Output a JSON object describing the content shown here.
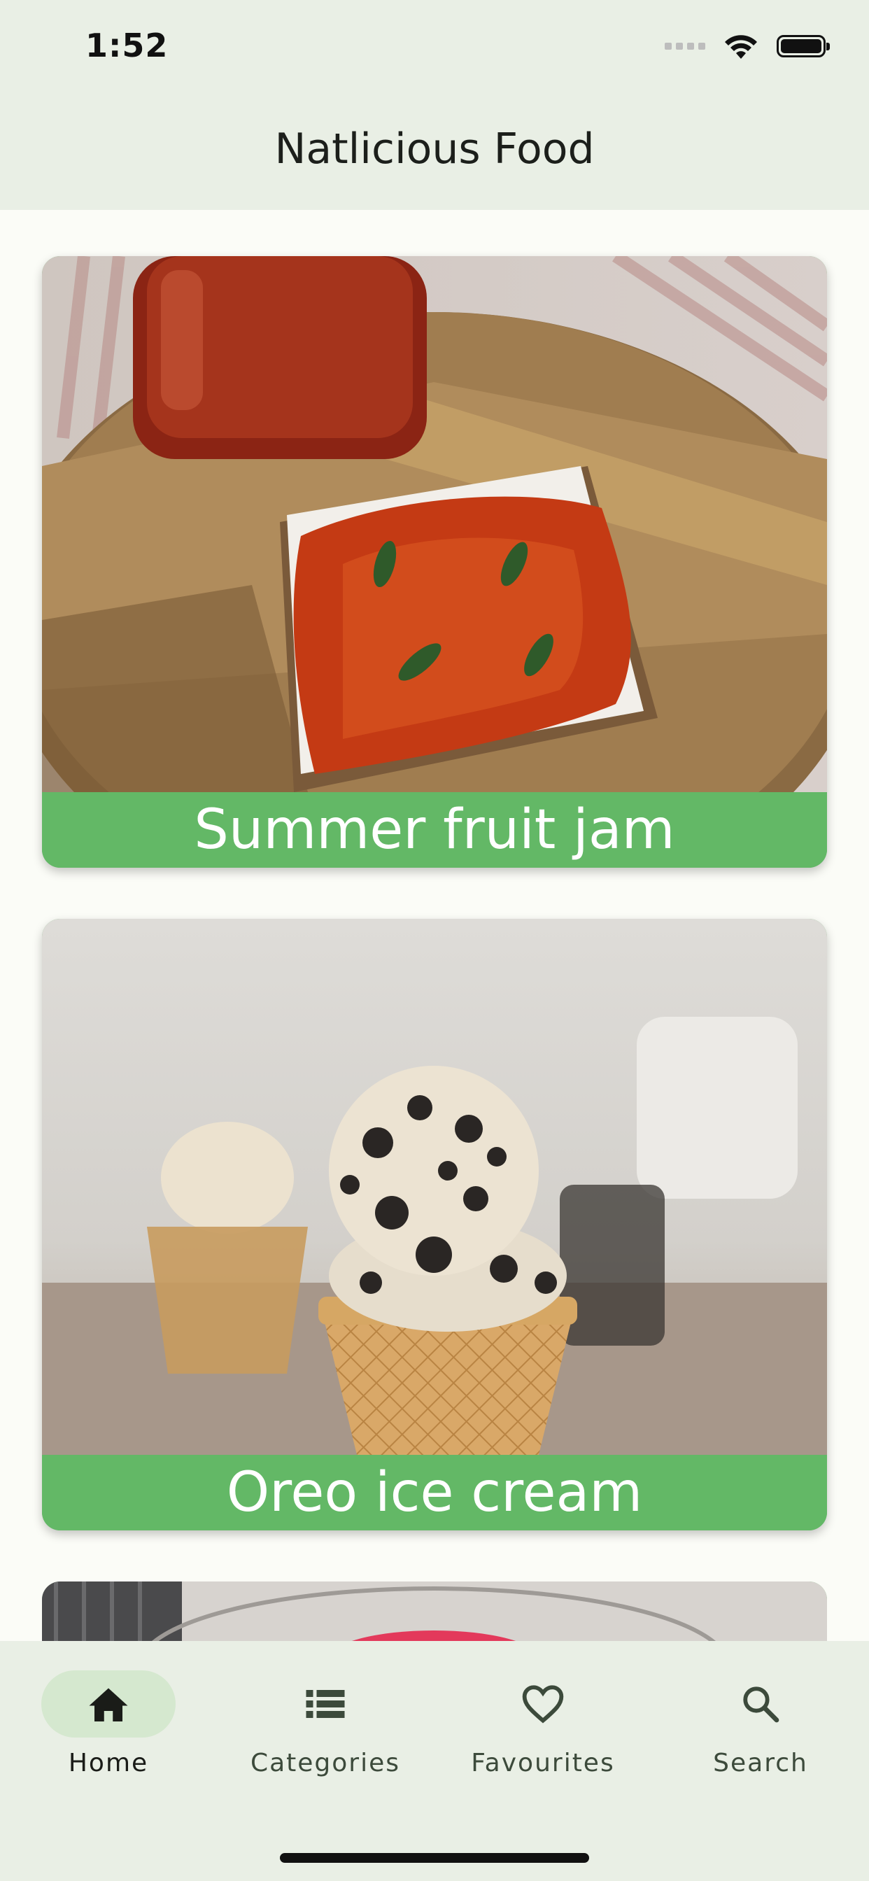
{
  "status_bar": {
    "time": "1:52"
  },
  "app_bar": {
    "title": "Natlicious Food"
  },
  "recipes": [
    {
      "title": "Summer fruit jam"
    },
    {
      "title": "Oreo ice cream"
    }
  ],
  "bottom_nav": {
    "items": [
      {
        "label": "Home",
        "icon": "home-icon",
        "active": true
      },
      {
        "label": "Categories",
        "icon": "list-icon",
        "active": false
      },
      {
        "label": "Favourites",
        "icon": "heart-icon",
        "active": false
      },
      {
        "label": "Search",
        "icon": "search-icon",
        "active": false
      }
    ]
  },
  "colors": {
    "bar_background": "#e9efe5",
    "page_background": "#fbfcf7",
    "card_label": "#63b866",
    "active_pill": "#d5e8cf"
  }
}
